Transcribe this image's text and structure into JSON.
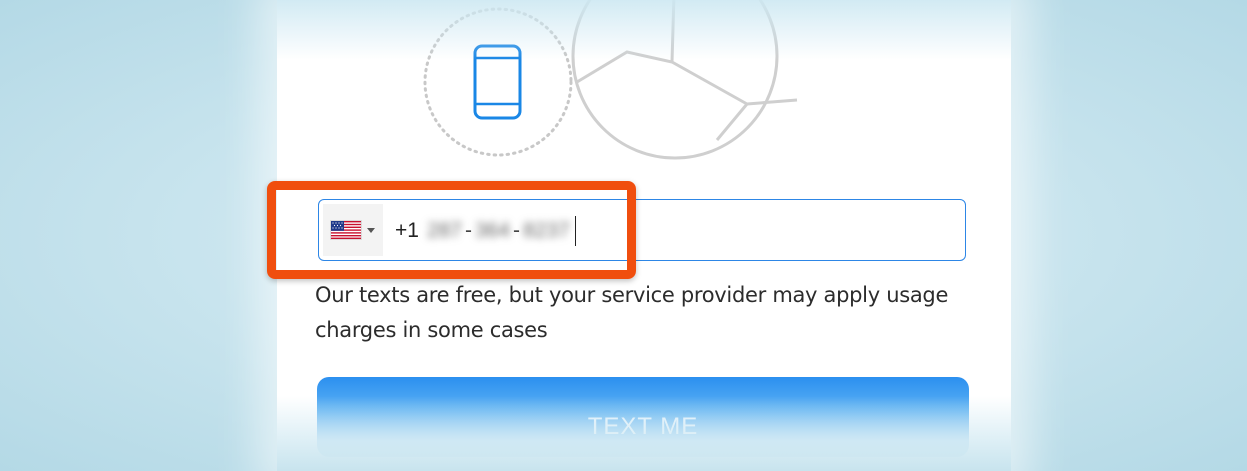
{
  "phone_entry": {
    "country": {
      "flag_icon": "us-flag-icon",
      "dropdown_icon": "caret-down-icon"
    },
    "country_code": "+1",
    "number_parts": [
      "287",
      "364",
      "8237"
    ],
    "separator": "-"
  },
  "note": "Our texts are free, but your service provider may apply usage charges in some cases",
  "button_label": "TEXT ME",
  "colors": {
    "highlight": "#f04e0e",
    "field_border": "#2d86e6",
    "button": "#2b8ff0",
    "phone_icon": "#1a87e6"
  }
}
